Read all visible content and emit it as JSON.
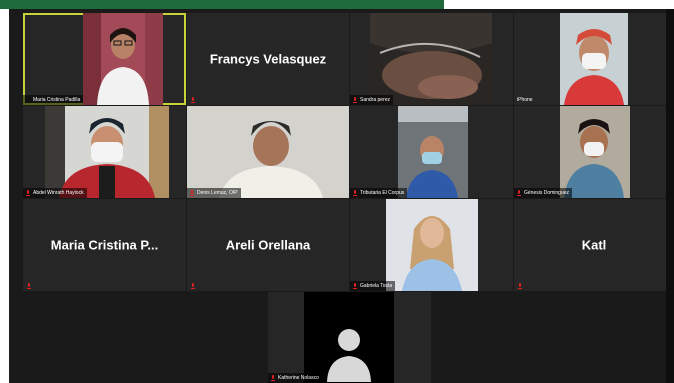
{
  "meeting": {
    "participants": [
      {
        "name": "Maria Cristina Padilla",
        "video": true,
        "active_speaker": true
      },
      {
        "name": "Francys Velasquez",
        "video": false
      },
      {
        "name": "Sandra perez",
        "video": true
      },
      {
        "name": "iPhone",
        "video": true
      },
      {
        "name": "Abdel Winrath Haylock",
        "video": true
      },
      {
        "name": "Denis Lemuz, OIP",
        "video": true
      },
      {
        "name": "Tributaria El Corpus",
        "video": true
      },
      {
        "name": "Génesis Dominguez",
        "video": true
      },
      {
        "name": "Maria Cristina P...",
        "video": false
      },
      {
        "name": "Areli Orellana",
        "video": false
      },
      {
        "name": "Gabriela Tosta",
        "video": true
      },
      {
        "name": "Katl",
        "video": false
      },
      {
        "name": "Katherine Nolasco",
        "video": false,
        "avatar": true
      }
    ]
  },
  "colors": {
    "brand_green": "#1f6b3c",
    "active_border": "#c6d43a",
    "muted_mic": "#e02020",
    "tile_bg": "#262626"
  },
  "icons": {
    "muted_mic": "mic-off-icon",
    "avatar": "person-avatar-icon"
  }
}
